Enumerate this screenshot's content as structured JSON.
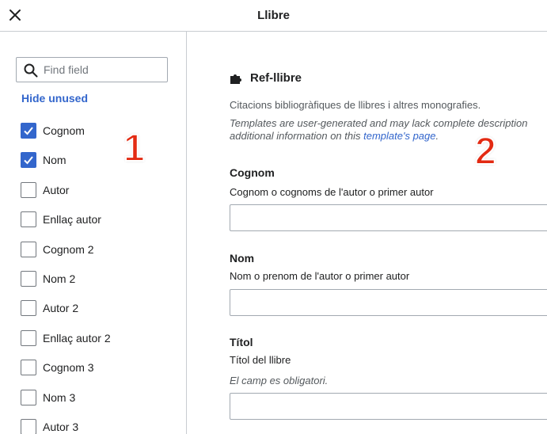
{
  "dialog": {
    "title": "Llibre"
  },
  "sidebar": {
    "search_placeholder": "Find field",
    "hide_unused": "Hide unused",
    "fields": [
      {
        "label": "Cognom",
        "checked": true
      },
      {
        "label": "Nom",
        "checked": true
      },
      {
        "label": "Autor",
        "checked": false
      },
      {
        "label": "Enllaç autor",
        "checked": false
      },
      {
        "label": "Cognom 2",
        "checked": false
      },
      {
        "label": "Nom 2",
        "checked": false
      },
      {
        "label": "Autor 2",
        "checked": false
      },
      {
        "label": "Enllaç autor 2",
        "checked": false
      },
      {
        "label": "Cognom 3",
        "checked": false
      },
      {
        "label": "Nom 3",
        "checked": false
      },
      {
        "label": "Autor 3",
        "checked": false
      }
    ]
  },
  "template": {
    "icon": "puzzle-icon",
    "name": "Ref-llibre",
    "description": "Citacions bibliogràfiques de llibres i altres monografies.",
    "note_line1": "Templates are user-generated and may lack complete description",
    "note_line2_prefix": "additional information on this ",
    "note_link": "template's page",
    "note_line2_suffix": "."
  },
  "params": [
    {
      "label": "Cognom",
      "description": "Cognom o cognoms de l'autor o primer autor",
      "value": ""
    },
    {
      "label": "Nom",
      "description": "Nom o prenom de l'autor o primer autor",
      "value": ""
    },
    {
      "label": "Títol",
      "description": "Títol del llibre",
      "required_note": "El camp es obligatori.",
      "value": ""
    }
  ],
  "annotations": {
    "callout_1": "1",
    "callout_2": "2"
  },
  "colors": {
    "accent": "#3366cc",
    "border": "#c8ccd1",
    "callout": "#e32a12"
  }
}
